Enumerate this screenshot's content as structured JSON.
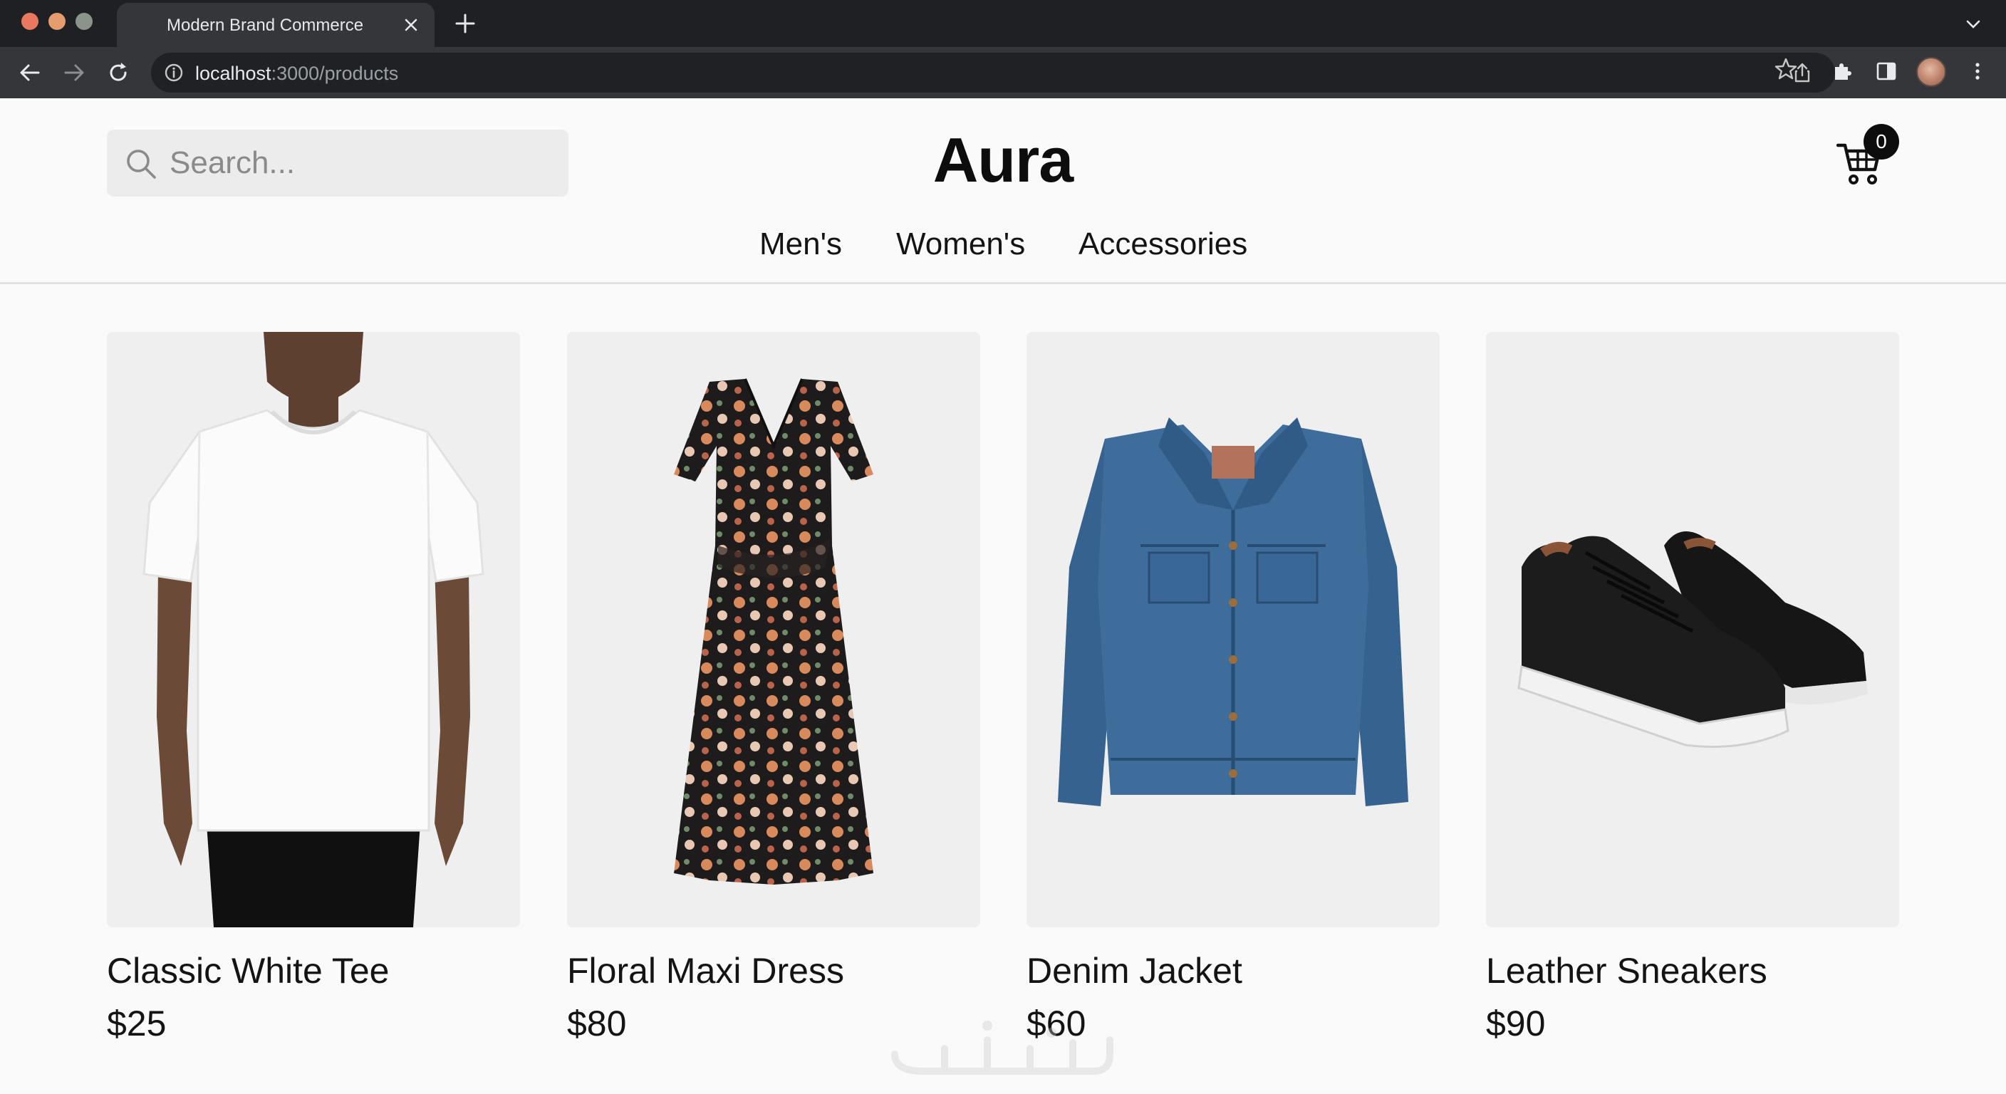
{
  "browser": {
    "tab_title": "Modern Brand Commerce",
    "url_host": "localhost",
    "url_path": ":3000/products",
    "icons": [
      "close-icon",
      "plus-icon",
      "chevron-down-icon",
      "back-arrow-icon",
      "forward-arrow-icon",
      "reload-icon",
      "info-icon",
      "share-icon",
      "star-icon",
      "extensions-icon",
      "side-panel-icon",
      "kebab-menu-icon"
    ]
  },
  "header": {
    "search_placeholder": "Search...",
    "brand": "Aura",
    "cart_count": "0"
  },
  "nav": {
    "items": [
      "Men's",
      "Women's",
      "Accessories"
    ]
  },
  "products": [
    {
      "name": "Classic White Tee",
      "price": "$25"
    },
    {
      "name": "Floral Maxi Dress",
      "price": "$80"
    },
    {
      "name": "Denim Jacket",
      "price": "$60"
    },
    {
      "name": "Leather Sneakers",
      "price": "$90"
    }
  ],
  "colors": {
    "chrome_dark": "#1f2024",
    "chrome_toolbar": "#35363a",
    "page_bg": "#fafafa",
    "text": "#141414",
    "card_bg": "#efefef"
  }
}
